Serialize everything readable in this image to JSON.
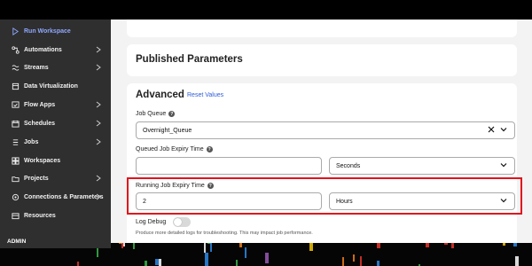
{
  "sidebar": {
    "items": [
      {
        "label": "Run Workspace",
        "icon": "play-icon",
        "chevron": false,
        "active": true
      },
      {
        "label": "Automations",
        "icon": "automation-icon",
        "chevron": true,
        "active": false
      },
      {
        "label": "Streams",
        "icon": "streams-icon",
        "chevron": true,
        "active": false
      },
      {
        "label": "Data Virtualization",
        "icon": "data-virtualization-icon",
        "chevron": false,
        "active": false
      },
      {
        "label": "Flow Apps",
        "icon": "flow-apps-icon",
        "chevron": true,
        "active": false
      },
      {
        "label": "Schedules",
        "icon": "schedules-icon",
        "chevron": true,
        "active": false
      },
      {
        "label": "Jobs",
        "icon": "jobs-icon",
        "chevron": true,
        "active": false
      },
      {
        "label": "Workspaces",
        "icon": "workspaces-icon",
        "chevron": false,
        "active": false
      },
      {
        "label": "Projects",
        "icon": "projects-icon",
        "chevron": true,
        "active": false
      },
      {
        "label": "Connections & Parameters",
        "icon": "connections-icon",
        "chevron": true,
        "active": false
      },
      {
        "label": "Resources",
        "icon": "resources-icon",
        "chevron": false,
        "active": false
      }
    ],
    "user": "ADMIN"
  },
  "published": {
    "title": "Published Parameters"
  },
  "advanced": {
    "title": "Advanced",
    "reset_label": "Reset Values",
    "job_queue": {
      "label": "Job Queue",
      "value": "Overnight_Queue"
    },
    "queued_expiry": {
      "label": "Queued Job Expiry Time",
      "value": "",
      "unit": "Seconds"
    },
    "running_expiry": {
      "label": "Running Job Expiry Time",
      "value": "2",
      "unit": "Hours"
    },
    "log_debug": {
      "label": "Log Debug",
      "enabled": false,
      "help": "Produce more detailed logs for troubleshooting. This may impact job performance."
    }
  },
  "colors": {
    "accent": "#2d5bd6",
    "active_nav": "#8fa8ff",
    "highlight": "#e0141d",
    "sidebar_bg": "#2f2f2f"
  }
}
